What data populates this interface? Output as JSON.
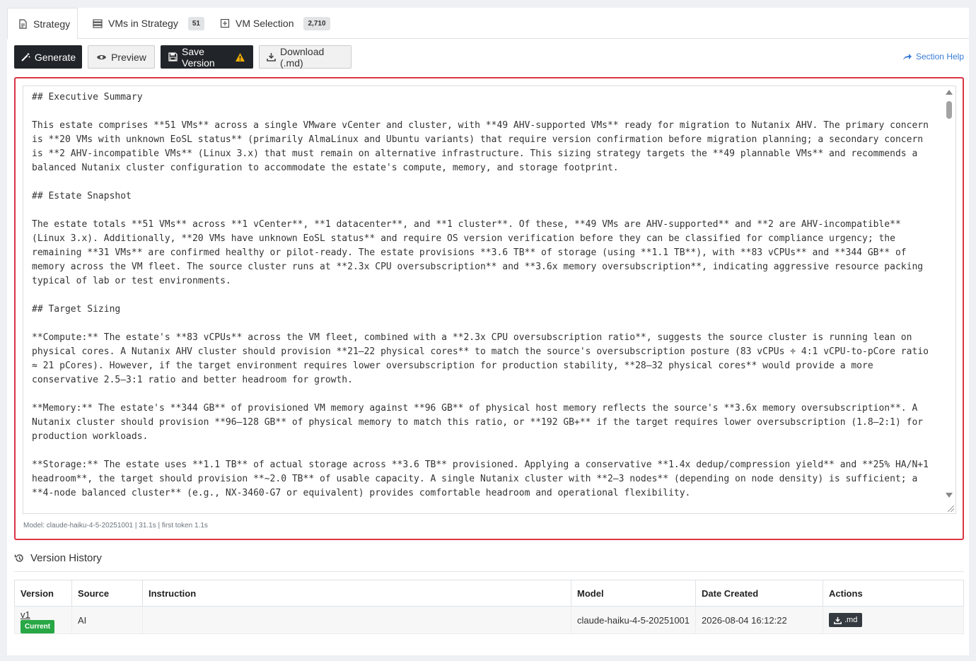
{
  "tabs": [
    {
      "label": "Strategy",
      "icon": "document-icon",
      "active": true
    },
    {
      "label": "VMs in Strategy",
      "icon": "server-icon",
      "count": "51"
    },
    {
      "label": "VM Selection",
      "icon": "plus-square-icon",
      "count": "2,710"
    }
  ],
  "toolbar": {
    "generate_label": "Generate",
    "preview_label": "Preview",
    "save_label": "Save Version",
    "download_label": "Download (.md)",
    "help_label": "Section Help"
  },
  "editor": {
    "content": "## Executive Summary\n\nThis estate comprises **51 VMs** across a single VMware vCenter and cluster, with **49 AHV-supported VMs** ready for migration to Nutanix AHV. The primary concern is **20 VMs with unknown EoSL status** (primarily AlmaLinux and Ubuntu variants) that require version confirmation before migration planning; a secondary concern is **2 AHV-incompatible VMs** (Linux 3.x) that must remain on alternative infrastructure. This sizing strategy targets the **49 plannable VMs** and recommends a balanced Nutanix cluster configuration to accommodate the estate's compute, memory, and storage footprint.\n\n## Estate Snapshot\n\nThe estate totals **51 VMs** across **1 vCenter**, **1 datacenter**, and **1 cluster**. Of these, **49 VMs are AHV-supported** and **2 are AHV-incompatible** (Linux 3.x). Additionally, **20 VMs have unknown EoSL status** and require OS version verification before they can be classified for compliance urgency; the remaining **31 VMs** are confirmed healthy or pilot-ready. The estate provisions **3.6 TB** of storage (using **1.1 TB**), with **83 vCPUs** and **344 GB** of memory across the VM fleet. The source cluster runs at **2.3x CPU oversubscription** and **3.6x memory oversubscription**, indicating aggressive resource packing typical of lab or test environments.\n\n## Target Sizing\n\n**Compute:** The estate's **83 vCPUs** across the VM fleet, combined with a **2.3x CPU oversubscription ratio**, suggests the source cluster is running lean on physical cores. A Nutanix AHV cluster should provision **21–22 physical cores** to match the source's oversubscription posture (83 vCPUs ÷ 4:1 vCPU-to-pCore ratio ≈ 21 pCores). However, if the target environment requires lower oversubscription for production stability, **28–32 physical cores** would provide a more conservative 2.5–3:1 ratio and better headroom for growth.\n\n**Memory:** The estate's **344 GB** of provisioned VM memory against **96 GB** of physical host memory reflects the source's **3.6x memory oversubscription**. A Nutanix cluster should provision **96–128 GB** of physical memory to match this ratio, or **192 GB+** if the target requires lower oversubscription (1.8–2:1) for production workloads.\n\n**Storage:** The estate uses **1.1 TB** of actual storage across **3.6 TB** provisioned. Applying a conservative **1.4x dedup/compression yield** and **25% HA/N+1 headroom**, the target should provision **~2.0 TB** of usable capacity. A single Nutanix cluster with **2–3 nodes** (depending on node density) is sufficient; a **4-node balanced cluster** (e.g., NX-3460-G7 or equivalent) provides comfortable headroom and operational flexibility.",
    "model_note": "Model: claude-haiku-4-5-20251001 | 31.1s | first token 1.1s"
  },
  "version_history": {
    "title": "Version History",
    "columns": [
      "Version",
      "Source",
      "Instruction",
      "Model",
      "Date Created",
      "Actions"
    ],
    "rows": [
      {
        "version": "v1",
        "badge": "Current",
        "source": "AI",
        "instruction": "",
        "model": "claude-haiku-4-5-20251001",
        "date_created": "2026-08-04 16:12:22",
        "action_label": ".md"
      }
    ]
  },
  "colors": {
    "accent_red": "#dc3545",
    "dark_button": "#212529",
    "current_badge": "#28a745",
    "help_link": "#3a7bd5",
    "warning": "#f0ad00"
  }
}
